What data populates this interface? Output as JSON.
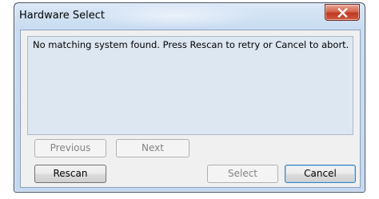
{
  "window": {
    "title": "Hardware Select",
    "close_icon": "close-x-icon"
  },
  "message": {
    "text": "No matching system found. Press Rescan to retry or Cancel to abort."
  },
  "buttons": {
    "previous": {
      "label": "Previous",
      "enabled": false
    },
    "next": {
      "label": "Next",
      "enabled": false
    },
    "rescan": {
      "label": "Rescan",
      "enabled": true
    },
    "select": {
      "label": "Select",
      "enabled": false
    },
    "cancel": {
      "label": "Cancel",
      "enabled": true,
      "default": true
    }
  },
  "colors": {
    "title_bar": "#c9dcf1",
    "close_button": "#c1381f",
    "message_background": "#dde7f2",
    "client_background": "#f0f0f0"
  }
}
